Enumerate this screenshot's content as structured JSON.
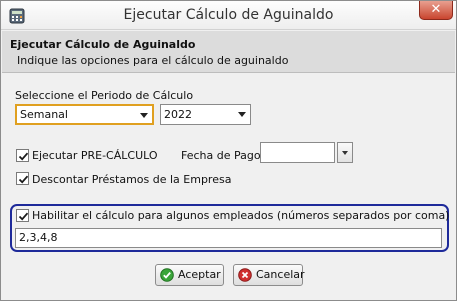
{
  "window": {
    "title": "Ejecutar Cálculo de Aguinaldo",
    "close_label": "✕"
  },
  "header": {
    "title": "Ejecutar Cálculo de Aguinaldo",
    "subtitle": "Indique las opciones para el cálculo de aguinaldo"
  },
  "form": {
    "period_label": "Seleccione el Periodo de Cálculo",
    "period_value": "Semanal",
    "year_value": "2022",
    "precalc_label": "Ejecutar PRE-CÁLCULO",
    "precalc_checked": true,
    "payment_date_label": "Fecha de Pago",
    "payment_date_value": "",
    "discount_loans_label": "Descontar Préstamos de la Empresa",
    "discount_loans_checked": true,
    "enable_employees_label": "Habilitar el cálculo para algunos empleados (números separados por coma)",
    "enable_employees_checked": true,
    "employees_value": "2,3,4,8"
  },
  "buttons": {
    "accept_label": "Aceptar",
    "cancel_label": "Cancelar"
  },
  "icons": {
    "app": "calculator-icon",
    "accept": "check-circle-icon",
    "cancel": "x-circle-icon"
  },
  "colors": {
    "highlight_border": "#1e2a9a",
    "active_select_border": "#e0a020",
    "accept_icon": "#3aa53a",
    "cancel_icon": "#d03030"
  }
}
